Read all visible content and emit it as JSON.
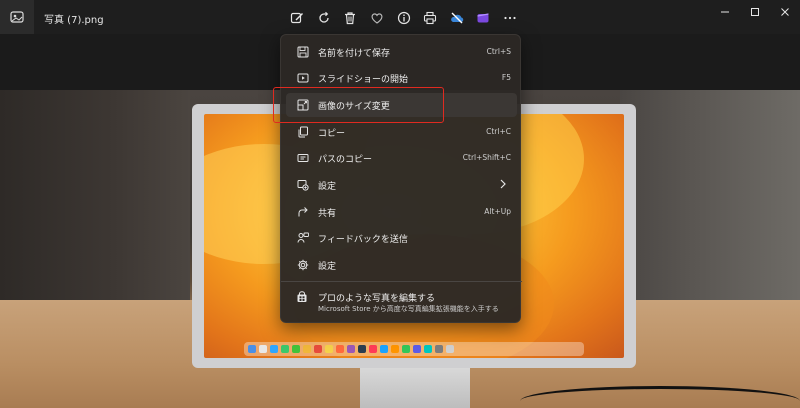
{
  "window": {
    "title": "写真 (7).png",
    "app_icon": "photos-icon"
  },
  "toolbar": {
    "buttons": [
      {
        "icon": "edit-image-icon"
      },
      {
        "icon": "rotate-icon"
      },
      {
        "icon": "delete-icon"
      },
      {
        "icon": "favorite-heart-icon"
      },
      {
        "icon": "info-icon"
      },
      {
        "icon": "print-icon"
      },
      {
        "icon": "onedrive-icon"
      },
      {
        "icon": "clipchamp-icon"
      },
      {
        "icon": "more-icon"
      }
    ]
  },
  "window_controls": [
    "minimize-icon",
    "maximize-icon",
    "close-icon"
  ],
  "context_menu": {
    "items": [
      {
        "label": "名前を付けて保存",
        "shortcut": "Ctrl+S",
        "icon": "save-icon"
      },
      {
        "label": "スライドショーの開始",
        "shortcut": "F5",
        "icon": "slideshow-icon"
      },
      {
        "label": "画像のサイズ変更",
        "shortcut": "",
        "icon": "resize-icon"
      },
      {
        "label": "コピー",
        "shortcut": "Ctrl+C",
        "icon": "copy-icon"
      },
      {
        "label": "パスのコピー",
        "shortcut": "Ctrl+Shift+C",
        "icon": "copy-path-icon"
      },
      {
        "label": "設定",
        "shortcut": "",
        "icon": "set-as-icon",
        "submenu": true
      },
      {
        "label": "共有",
        "shortcut": "Alt+Up",
        "icon": "share-icon"
      },
      {
        "label": "フィードバックを送信",
        "shortcut": "",
        "icon": "feedback-icon"
      },
      {
        "label": "設定",
        "shortcut": "",
        "icon": "settings-gear-icon"
      }
    ],
    "promo": {
      "title": "プロのような写真を編集する",
      "subtitle": "Microsoft Store から高度な写真編集拡張機能を入手する",
      "icon": "store-icon"
    }
  },
  "colors": {
    "highlight_box": "#e02a20",
    "menu_background": "#2c2825"
  }
}
